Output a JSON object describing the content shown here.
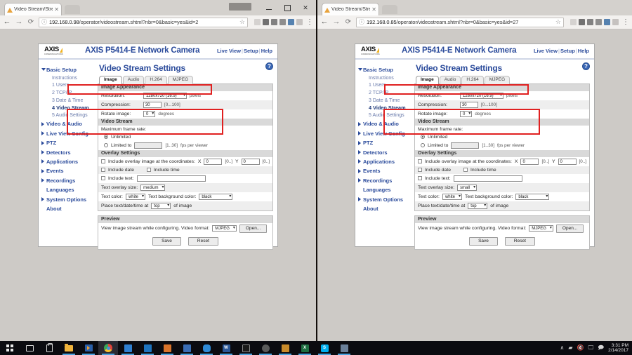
{
  "windows": [
    {
      "id": "left",
      "tab": {
        "title": "Video Stream/Stream Se",
        "close": "✕"
      },
      "omnibox": {
        "info_icon": "ⓘ",
        "host": "192.168.0.98",
        "path": "/operator/videostream.shtml?nbr=0&basic=yes&id=2",
        "star": "☆"
      },
      "window_controls": {
        "minimize": "—",
        "maximize": "❐",
        "close": "✕"
      },
      "header": {
        "logo": "AXIS",
        "logo_sub": "COMMUNICATIONS",
        "product": "AXIS P5414-E Network Camera",
        "links": [
          "Live View",
          "Setup",
          "Help"
        ]
      },
      "sidebar": [
        {
          "label": "Basic Setup",
          "type": "group-open"
        },
        {
          "label": "Instructions",
          "type": "sub"
        },
        {
          "label": "1 Users",
          "type": "sub"
        },
        {
          "label": "2 TCP/IP",
          "type": "sub"
        },
        {
          "label": "3 Date & Time",
          "type": "sub"
        },
        {
          "label": "4 Video Stream",
          "type": "sub-active"
        },
        {
          "label": "5 Audio Settings",
          "type": "sub"
        },
        {
          "label": "Video & Audio",
          "type": "group"
        },
        {
          "label": "Live View Config",
          "type": "group"
        },
        {
          "label": "PTZ",
          "type": "group"
        },
        {
          "label": "Detectors",
          "type": "group"
        },
        {
          "label": "Applications",
          "type": "group"
        },
        {
          "label": "Events",
          "type": "group"
        },
        {
          "label": "Recordings",
          "type": "group"
        },
        {
          "label": "Languages",
          "type": "plain"
        },
        {
          "label": "System Options",
          "type": "group"
        },
        {
          "label": "About",
          "type": "plain"
        }
      ],
      "page_title": "Video Stream Settings",
      "help_icon": "?",
      "tabs": [
        {
          "label": "Image",
          "active": true
        },
        {
          "label": "Audio",
          "active": false
        },
        {
          "label": "H.264",
          "active": false
        },
        {
          "label": "MJPEG",
          "active": false
        }
      ],
      "image_appearance": {
        "section": "Image Appearance",
        "resolution_label": "Resolution:",
        "resolution_value": "1280x720 (16:9)",
        "resolution_unit": "pixels",
        "compression_label": "Compression:",
        "compression_value": "30",
        "compression_hint": "[0...100]",
        "rotate_label": "Rotate image:",
        "rotate_value": "0",
        "rotate_unit": "degrees"
      },
      "video_stream": {
        "section": "Video Stream",
        "max_fps_label": "Maximum frame rate:",
        "unlimited_label": "Unlimited",
        "unlimited_selected": true,
        "limited_label": "Limited to",
        "limited_value": "",
        "limited_hint": "[1..30]",
        "limited_unit": "fps per viewer"
      },
      "overlay": {
        "section": "Overlay Settings",
        "include_overlay_label": "Include overlay image at the coordinates:",
        "x_label": "X",
        "x_value": "0",
        "x_hint": "[0..]",
        "y_label": "Y",
        "y_value": "0",
        "y_hint": "[0..]",
        "include_date": "Include date",
        "include_time": "Include time",
        "include_text": "Include text:",
        "include_text_value": "",
        "text_size_label": "Text overlay size:",
        "text_size_value": "medium",
        "text_color_label": "Text color:",
        "text_color_value": "white",
        "text_bg_label": "Text background color:",
        "text_bg_value": "black",
        "place_label": "Place text/date/time at",
        "place_value": "top",
        "place_suffix": "of image"
      },
      "preview": {
        "section": "Preview",
        "text": "View image stream while configuring.  Video format:",
        "format_value": "MJPEG",
        "open_button": "Open..."
      },
      "buttons": {
        "save": "Save",
        "reset": "Reset"
      }
    },
    {
      "id": "right",
      "tab": {
        "title": "Video Stream/Stream Se",
        "close": "✕"
      },
      "omnibox": {
        "info_icon": "ⓘ",
        "host": "192.168.0.85",
        "path": "/operator/videostream.shtml?nbr=0&basic=yes&id=27",
        "star": "☆"
      },
      "window_controls": {
        "minimize": "—",
        "maximize": "❐",
        "close": "✕"
      },
      "header": {
        "logo": "AXIS",
        "logo_sub": "COMMUNICATIONS",
        "product": "AXIS P5414-E Network Camera",
        "links": [
          "Live View",
          "Setup",
          "Help"
        ]
      },
      "sidebar": [
        {
          "label": "Basic Setup",
          "type": "group-open"
        },
        {
          "label": "Instructions",
          "type": "sub"
        },
        {
          "label": "1 Users",
          "type": "sub"
        },
        {
          "label": "2 TCP/IP",
          "type": "sub"
        },
        {
          "label": "3 Date & Time",
          "type": "sub"
        },
        {
          "label": "4 Video Stream",
          "type": "sub-active"
        },
        {
          "label": "5 Audio Settings",
          "type": "sub"
        },
        {
          "label": "Video & Audio",
          "type": "group"
        },
        {
          "label": "Live View Config",
          "type": "group"
        },
        {
          "label": "PTZ",
          "type": "group"
        },
        {
          "label": "Detectors",
          "type": "group"
        },
        {
          "label": "Applications",
          "type": "group"
        },
        {
          "label": "Events",
          "type": "group"
        },
        {
          "label": "Recordings",
          "type": "group"
        },
        {
          "label": "Languages",
          "type": "plain"
        },
        {
          "label": "System Options",
          "type": "group"
        },
        {
          "label": "About",
          "type": "plain"
        }
      ],
      "page_title": "Video Stream Settings",
      "help_icon": "?",
      "tabs": [
        {
          "label": "Image",
          "active": true
        },
        {
          "label": "Audio",
          "active": false
        },
        {
          "label": "H.264",
          "active": false
        },
        {
          "label": "MJPEG",
          "active": false
        }
      ],
      "image_appearance": {
        "section": "Image Appearance",
        "resolution_label": "Resolution:",
        "resolution_value": "1280x720 (16:9)",
        "resolution_unit": "pixels",
        "compression_label": "Compression:",
        "compression_value": "30",
        "compression_hint": "[0...100]",
        "rotate_label": "Rotate image:",
        "rotate_value": "0",
        "rotate_unit": "degrees"
      },
      "video_stream": {
        "section": "Video Stream",
        "max_fps_label": "Maximum frame rate:",
        "unlimited_label": "Unlimited",
        "unlimited_selected": true,
        "limited_label": "Limited to",
        "limited_value": "",
        "limited_hint": "[1..30]",
        "limited_unit": "fps per viewer"
      },
      "overlay": {
        "section": "Overlay Settings",
        "include_overlay_label": "Include overlay image at the coordinates:",
        "x_label": "X",
        "x_value": "0",
        "x_hint": "[0..]",
        "y_label": "Y",
        "y_value": "0",
        "y_hint": "[0..]",
        "include_date": "Include date",
        "include_time": "Include time",
        "include_text": "Include text:",
        "include_text_value": "",
        "text_size_label": "Text overlay size:",
        "text_size_value": "small",
        "text_color_label": "Text color:",
        "text_color_value": "white",
        "text_bg_label": "Text background color:",
        "text_bg_value": "black",
        "place_label": "Place text/date/time at",
        "place_value": "top",
        "place_suffix": "of image"
      },
      "preview": {
        "section": "Preview",
        "text": "View image stream while configuring.  Video format:",
        "format_value": "MJPEG",
        "open_button": "Open..."
      },
      "buttons": {
        "save": "Save",
        "reset": "Reset"
      }
    }
  ],
  "annotations": {
    "accent_color": "#e02020"
  },
  "taskbar": {
    "items": [
      {
        "name": "start-button",
        "icon": "windows-logo-icon"
      },
      {
        "name": "task-view-button",
        "icon": "task-view-icon"
      },
      {
        "name": "store-button",
        "icon": "store-icon"
      },
      {
        "name": "file-explorer-button",
        "icon": "folder-icon"
      },
      {
        "name": "media-player-button",
        "icon": "media-player-icon"
      },
      {
        "name": "chrome-button",
        "icon": "chrome-icon"
      },
      {
        "name": "app-7-button",
        "icon": "book-icon"
      },
      {
        "name": "app-8-button",
        "icon": "blue-app-icon"
      },
      {
        "name": "outlook-button",
        "icon": "outlook-icon"
      },
      {
        "name": "visio-button",
        "icon": "visio-icon"
      },
      {
        "name": "onedrive-button",
        "icon": "cloud-icon"
      },
      {
        "name": "word-button",
        "icon": "word-icon",
        "glyph": "W"
      },
      {
        "name": "command-prompt-button",
        "icon": "terminal-icon"
      },
      {
        "name": "tool-button",
        "icon": "tool-icon"
      },
      {
        "name": "notes-button",
        "icon": "notes-icon"
      },
      {
        "name": "excel-button",
        "icon": "excel-icon",
        "glyph": "X"
      },
      {
        "name": "skype-button",
        "icon": "skype-icon",
        "glyph": "S"
      },
      {
        "name": "network-app-button",
        "icon": "network-icon"
      }
    ],
    "tray": {
      "show_hidden": "∧",
      "network_icon": "network-tray-icon",
      "volume_icon": "volume-muted-icon",
      "display_icon": "display-icon",
      "action_center_icon": "action-center-icon",
      "time": "3:31 PM",
      "date": "2/14/2017"
    }
  }
}
